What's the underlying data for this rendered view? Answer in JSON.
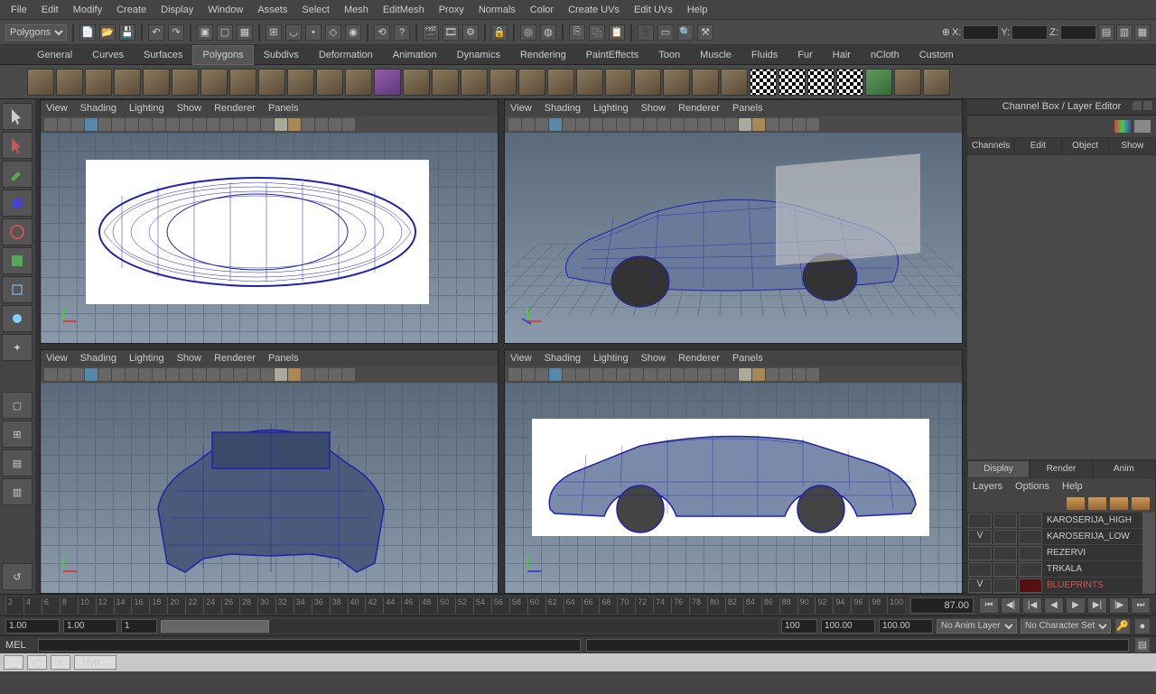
{
  "menu": [
    "File",
    "Edit",
    "Modify",
    "Create",
    "Display",
    "Window",
    "Assets",
    "Select",
    "Mesh",
    "EditMesh",
    "Proxy",
    "Normals",
    "Color",
    "Create UVs",
    "Edit UVs",
    "Help"
  ],
  "mode_selector": "Polygons",
  "coords": {
    "x": "X:",
    "y": "Y:",
    "z": "Z:"
  },
  "shelf_tabs": [
    "General",
    "Curves",
    "Surfaces",
    "Polygons",
    "Subdivs",
    "Deformation",
    "Animation",
    "Dynamics",
    "Rendering",
    "PaintEffects",
    "Toon",
    "Muscle",
    "Fluids",
    "Fur",
    "Hair",
    "nCloth",
    "Custom"
  ],
  "shelf_active": "Polygons",
  "viewport_menu": [
    "View",
    "Shading",
    "Lighting",
    "Show",
    "Renderer",
    "Panels"
  ],
  "sidepanel": {
    "title": "Channel Box / Layer Editor",
    "tabs": [
      "Channels",
      "Edit",
      "Object",
      "Show"
    ]
  },
  "layerbox": {
    "tabs": [
      "Display",
      "Render",
      "Anim"
    ],
    "active": "Display",
    "menu": [
      "Layers",
      "Options",
      "Help"
    ],
    "rows": [
      {
        "v": "",
        "name": "KAROSERIJA_HIGH",
        "red": false
      },
      {
        "v": "V",
        "name": "KAROSERIJA_LOW",
        "red": false
      },
      {
        "v": "",
        "name": "REZERVI",
        "red": false
      },
      {
        "v": "",
        "name": "TRKALA",
        "red": false
      },
      {
        "v": "V",
        "name": "BLUEPRINTS",
        "red": true
      }
    ]
  },
  "timeline": {
    "current": "87.00",
    "ticks": [
      "2",
      "4",
      "6",
      "8",
      "10",
      "12",
      "14",
      "16",
      "18",
      "20",
      "22",
      "24",
      "26",
      "28",
      "30",
      "32",
      "34",
      "36",
      "38",
      "40",
      "42",
      "44",
      "46",
      "48",
      "50",
      "52",
      "54",
      "56",
      "58",
      "60",
      "62",
      "64",
      "66",
      "68",
      "70",
      "72",
      "74",
      "76",
      "78",
      "80",
      "82",
      "84",
      "86",
      "88",
      "90",
      "92",
      "94",
      "96",
      "98",
      "100"
    ]
  },
  "range": {
    "start": "1.00",
    "playstart": "1.00",
    "playend": "1",
    "end": "100",
    "end2": "100.00",
    "end3": "100.00",
    "animlayer": "No Anim Layer",
    "charset": "No Character Set"
  },
  "cmdline": {
    "label": "MEL"
  },
  "bottombar": {
    "tab": "Hyp..."
  }
}
